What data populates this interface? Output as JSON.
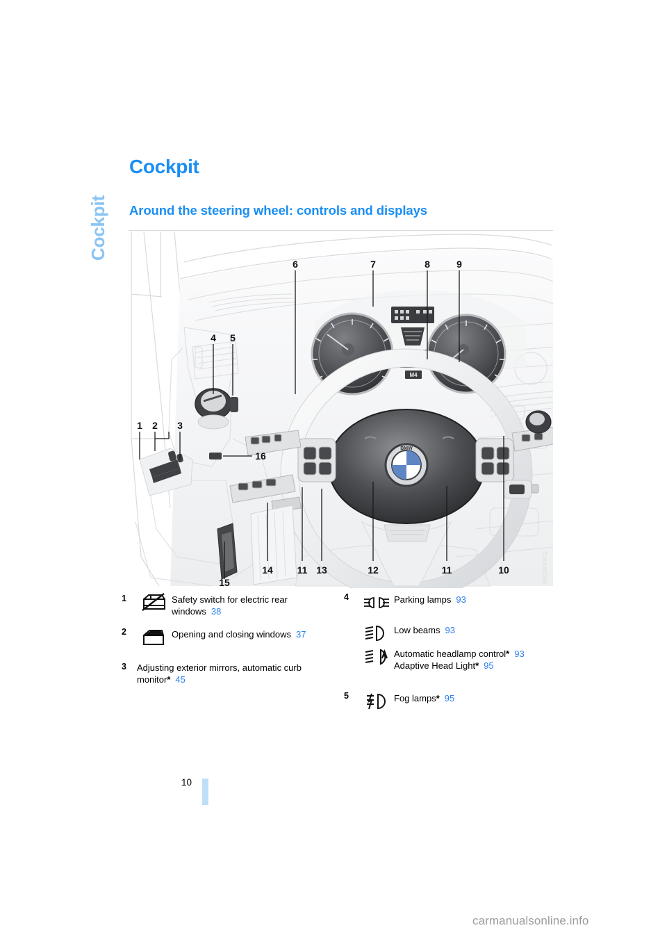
{
  "chapter_tab": {
    "label": "Cockpit"
  },
  "headings": {
    "page_title": "Cockpit",
    "section_title": "Around the steering wheel: controls and displays"
  },
  "illustration": {
    "image_code": "WKDBSWO",
    "callouts": [
      "1",
      "2",
      "3",
      "4",
      "5",
      "6",
      "7",
      "8",
      "9",
      "10",
      "11",
      "11",
      "12",
      "13",
      "14",
      "15",
      "16"
    ]
  },
  "legend": {
    "left_column": [
      {
        "number": "1",
        "icon": "window-safety-switch-icon",
        "lines": [
          {
            "text": "Safety switch for electric rear",
            "page": ""
          },
          {
            "text": "windows",
            "page": "38"
          }
        ]
      },
      {
        "number": "2",
        "icon": "car-window-icon",
        "lines": [
          {
            "text": "Opening and closing windows",
            "page": "37"
          }
        ]
      },
      {
        "number": "3",
        "icon": "",
        "lines": [
          {
            "text": "Adjusting exterior mirrors, automatic curb",
            "page": ""
          },
          {
            "text": "monitor",
            "star": "*",
            "page": "45"
          }
        ]
      }
    ],
    "right_column": [
      {
        "number": "4",
        "icon": "parking-lamps-icon",
        "lines": [
          {
            "text": "Parking lamps",
            "page": "93"
          }
        ]
      },
      {
        "number": "",
        "icon": "low-beams-icon",
        "lines": [
          {
            "text": "Low beams",
            "page": "93"
          }
        ]
      },
      {
        "number": "",
        "icon": "automatic-headlamp-control-icon",
        "lines": [
          {
            "text": "Automatic headlamp control",
            "star": "*",
            "page": "93"
          },
          {
            "text": "Adaptive Head Light",
            "star": "*",
            "page": "95"
          }
        ]
      },
      {
        "number": "5",
        "icon": "fog-lamps-icon",
        "lines": [
          {
            "text": "Fog lamps",
            "star": "*",
            "page": "95"
          }
        ]
      }
    ]
  },
  "footer": {
    "page_number": "10",
    "watermark": "carmanualsonline.info"
  },
  "colors": {
    "heading_blue": "#1b8ef2",
    "tab_blue": "#89c4f4",
    "page_ref_blue": "#2d7ff0",
    "marker_blue": "#bddff8"
  }
}
